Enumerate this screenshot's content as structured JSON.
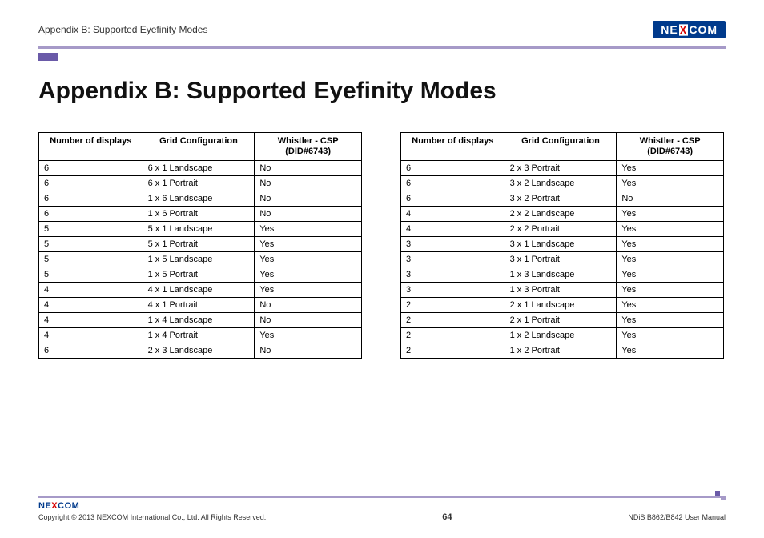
{
  "header": {
    "section_label": "Appendix B: Supported Eyefinity Modes",
    "logo_left": "NE",
    "logo_x": "X",
    "logo_right": "COM"
  },
  "title": "Appendix B: Supported Eyefinity Modes",
  "table_headers": {
    "col1": "Number of displays",
    "col2": "Grid Configuration",
    "col3_line1": "Whistler - CSP",
    "col3_line2": "(DID#6743)"
  },
  "left_rows": [
    {
      "n": "6",
      "g": "6 x 1 Landscape",
      "w": "No"
    },
    {
      "n": "6",
      "g": "6 x 1 Portrait",
      "w": "No"
    },
    {
      "n": "6",
      "g": "1 x 6 Landscape",
      "w": "No"
    },
    {
      "n": "6",
      "g": "1 x 6 Portrait",
      "w": "No"
    },
    {
      "n": "5",
      "g": "5 x 1 Landscape",
      "w": "Yes"
    },
    {
      "n": "5",
      "g": "5 x 1 Portrait",
      "w": "Yes"
    },
    {
      "n": "5",
      "g": "1 x 5 Landscape",
      "w": "Yes"
    },
    {
      "n": "5",
      "g": "1 x 5 Portrait",
      "w": "Yes"
    },
    {
      "n": "4",
      "g": "4 x 1 Landscape",
      "w": "Yes"
    },
    {
      "n": "4",
      "g": "4 x 1 Portrait",
      "w": "No"
    },
    {
      "n": "4",
      "g": "1 x 4 Landscape",
      "w": "No"
    },
    {
      "n": "4",
      "g": "1 x 4 Portrait",
      "w": "Yes"
    },
    {
      "n": "6",
      "g": "2 x 3 Landscape",
      "w": "No"
    }
  ],
  "right_rows": [
    {
      "n": "6",
      "g": "2 x 3 Portrait",
      "w": "Yes"
    },
    {
      "n": "6",
      "g": "3 x 2 Landscape",
      "w": "Yes"
    },
    {
      "n": "6",
      "g": "3 x 2 Portrait",
      "w": "No"
    },
    {
      "n": "4",
      "g": "2 x 2 Landscape",
      "w": "Yes"
    },
    {
      "n": "4",
      "g": "2 x 2 Portrait",
      "w": "Yes"
    },
    {
      "n": "3",
      "g": "3 x 1 Landscape",
      "w": "Yes"
    },
    {
      "n": "3",
      "g": "3 x 1 Portrait",
      "w": "Yes"
    },
    {
      "n": "3",
      "g": "1 x 3 Landscape",
      "w": "Yes"
    },
    {
      "n": "3",
      "g": "1 x 3 Portrait",
      "w": "Yes"
    },
    {
      "n": "2",
      "g": "2 x 1 Landscape",
      "w": "Yes"
    },
    {
      "n": "2",
      "g": "2 x 1 Portrait",
      "w": "Yes"
    },
    {
      "n": "2",
      "g": "1 x 2 Landscape",
      "w": "Yes"
    },
    {
      "n": "2",
      "g": "1 x 2 Portrait",
      "w": "Yes"
    }
  ],
  "footer": {
    "logo_left": "NE",
    "logo_x": "X",
    "logo_right": "COM",
    "copyright": "Copyright © 2013 NEXCOM International Co., Ltd. All Rights Reserved.",
    "page_number": "64",
    "manual": "NDiS B862/B842 User Manual"
  }
}
